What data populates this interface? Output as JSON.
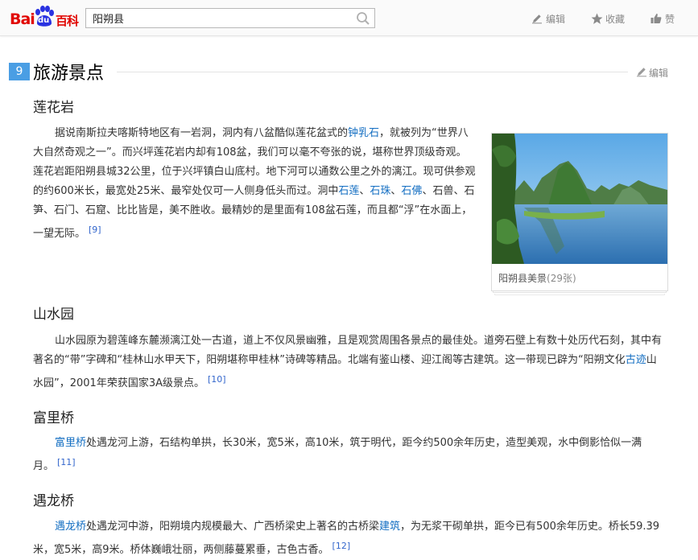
{
  "header": {
    "logo": {
      "bai": "Bai",
      "du": "du",
      "baike": "百科"
    },
    "search": {
      "value": "阳朔县",
      "icon": "search-icon"
    },
    "tools": {
      "edit": {
        "label": "编辑",
        "icon": "pencil-icon"
      },
      "favorite": {
        "label": "收藏",
        "icon": "star-icon"
      },
      "like": {
        "label": "赞",
        "icon": "thumbs-up-icon"
      }
    }
  },
  "section": {
    "number": "9",
    "title": "旅游景点",
    "edit_label": "编辑"
  },
  "subsections": [
    {
      "title": "莲花岩",
      "text": {
        "p1": "据说南斯拉夫喀斯特地区有一岩洞，洞内有八盆酷似莲花盆式的",
        "link1": "钟乳石",
        "p2": "，就被列为“世界八大自然奇观之一”。而兴坪莲花岩内却有108盆，我们可以毫不夸张的说，堪称世界顶级奇观。莲花岩距阳朔县城32公里，位于兴坪镇白山底村。地下河可以通数公里之外的漓江。现可供参观的约600米长，最宽处25米、最窄处仅可一人侧身低头而过。洞中",
        "link2": "石莲",
        "sep1": "、",
        "link3": "石珠",
        "sep2": "、",
        "link4": "石佛",
        "p3": "、石兽、石笋、石门、石窟、比比皆是，美不胜收。最精妙的是里面有108盆石莲，而且都“浮”在水面上，一望无际。",
        "ref": "[9]"
      }
    },
    {
      "title": "山水园",
      "text": {
        "p1": "山水园原为碧莲峰东麓濒漓江处一古道，道上不仅风景幽雅，且是观赏周围各景点的最佳处。道旁石壁上有数十处历代石刻，其中有著名的“带”字碑和“桂林山水甲天下，阳朔堪称甲桂林”诗碑等精品。北端有鉴山楼、迎江阁等古建筑。这一带现已辟为“阳朔文化",
        "link1": "古迹",
        "p2": "山水园”，2001年荣获国家3A级景点。",
        "ref": "[10]"
      }
    },
    {
      "title": "富里桥",
      "text": {
        "link1": "富里桥",
        "p1": "处遇龙河上游，石结构单拱，长30米，宽5米，高10米，筑于明代，距今约500余年历史，造型美观，水中倒影恰似一满月。",
        "ref": "[11]"
      }
    },
    {
      "title": "遇龙桥",
      "text": {
        "link1": "遇龙桥",
        "p1": "处遇龙河中游，阳朔境内规模最大、广西桥梁史上著名的古桥梁",
        "link2": "建筑",
        "p2": "，为无浆干砌单拱，距今已有500余年历史。桥长59.39米，宽5米，高9米。桥体巍峨壮丽，两侧藤蔓累垂，古色古香。",
        "ref": "[12]"
      }
    }
  ],
  "image_card": {
    "caption": "阳朔县美景",
    "count": "(29张)"
  }
}
